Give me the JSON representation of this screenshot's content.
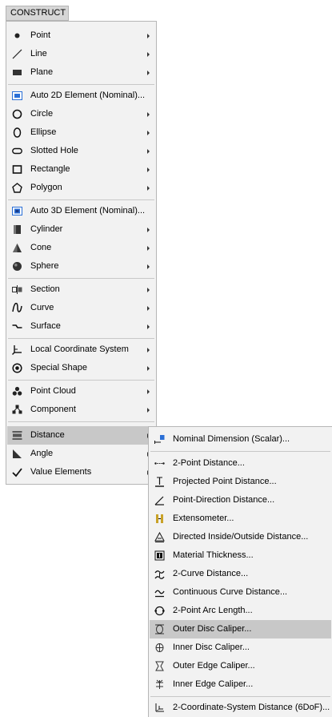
{
  "menubar": {
    "title": "CONSTRUCT"
  },
  "main_menu": {
    "items": [
      {
        "label": "Point",
        "icon": "point-icon",
        "submenu": true
      },
      {
        "label": "Line",
        "icon": "line-icon",
        "submenu": true
      },
      {
        "label": "Plane",
        "icon": "plane-icon",
        "submenu": true
      },
      {
        "label": "Auto 2D Element (Nominal)...",
        "icon": "auto-2d-element-icon",
        "submenu": false
      },
      {
        "label": "Circle",
        "icon": "circle-icon",
        "submenu": true
      },
      {
        "label": "Ellipse",
        "icon": "ellipse-icon",
        "submenu": true
      },
      {
        "label": "Slotted Hole",
        "icon": "slotted-hole-icon",
        "submenu": true
      },
      {
        "label": "Rectangle",
        "icon": "rectangle-icon",
        "submenu": true
      },
      {
        "label": "Polygon",
        "icon": "polygon-icon",
        "submenu": true
      },
      {
        "label": "Auto 3D Element (Nominal)...",
        "icon": "auto-3d-element-icon",
        "submenu": false
      },
      {
        "label": "Cylinder",
        "icon": "cylinder-icon",
        "submenu": true
      },
      {
        "label": "Cone",
        "icon": "cone-icon",
        "submenu": true
      },
      {
        "label": "Sphere",
        "icon": "sphere-icon",
        "submenu": true
      },
      {
        "label": "Section",
        "icon": "section-icon",
        "submenu": true
      },
      {
        "label": "Curve",
        "icon": "curve-icon",
        "submenu": true
      },
      {
        "label": "Surface",
        "icon": "surface-icon",
        "submenu": true
      },
      {
        "label": "Local Coordinate System",
        "icon": "coordinate-system-icon",
        "submenu": true
      },
      {
        "label": "Special Shape",
        "icon": "special-shape-icon",
        "submenu": true
      },
      {
        "label": "Point Cloud",
        "icon": "point-cloud-icon",
        "submenu": true
      },
      {
        "label": "Component",
        "icon": "component-icon",
        "submenu": true
      },
      {
        "label": "Distance",
        "icon": "distance-icon",
        "submenu": true,
        "highlighted": true
      },
      {
        "label": "Angle",
        "icon": "angle-icon",
        "submenu": true
      },
      {
        "label": "Value Elements",
        "icon": "value-elements-icon",
        "submenu": true
      }
    ]
  },
  "distance_submenu": {
    "items": [
      {
        "label": "Nominal Dimension (Scalar)...",
        "icon": "nominal-dimension-icon"
      },
      {
        "label": "2-Point Distance...",
        "icon": "two-point-distance-icon"
      },
      {
        "label": "Projected Point Distance...",
        "icon": "projected-point-distance-icon"
      },
      {
        "label": "Point-Direction Distance...",
        "icon": "point-direction-distance-icon"
      },
      {
        "label": "Extensometer...",
        "icon": "extensometer-icon"
      },
      {
        "label": "Directed Inside/Outside Distance...",
        "icon": "directed-distance-icon"
      },
      {
        "label": "Material Thickness...",
        "icon": "material-thickness-icon"
      },
      {
        "label": "2-Curve Distance...",
        "icon": "two-curve-distance-icon"
      },
      {
        "label": "Continuous Curve Distance...",
        "icon": "continuous-curve-distance-icon"
      },
      {
        "label": "2-Point Arc Length...",
        "icon": "arc-length-icon"
      },
      {
        "label": "Outer Disc Caliper...",
        "icon": "outer-disc-caliper-icon",
        "highlighted": true
      },
      {
        "label": "Inner Disc Caliper...",
        "icon": "inner-disc-caliper-icon"
      },
      {
        "label": "Outer Edge Caliper...",
        "icon": "outer-edge-caliper-icon"
      },
      {
        "label": "Inner Edge Caliper...",
        "icon": "inner-edge-caliper-icon"
      },
      {
        "label": "2-Coordinate-System Distance (6DoF)...",
        "icon": "six-dof-distance-icon"
      }
    ]
  },
  "colors": {
    "accent_blue": "#2a6fd6",
    "highlight": "#c8c8c8",
    "menu_bg": "#f2f2f2"
  }
}
